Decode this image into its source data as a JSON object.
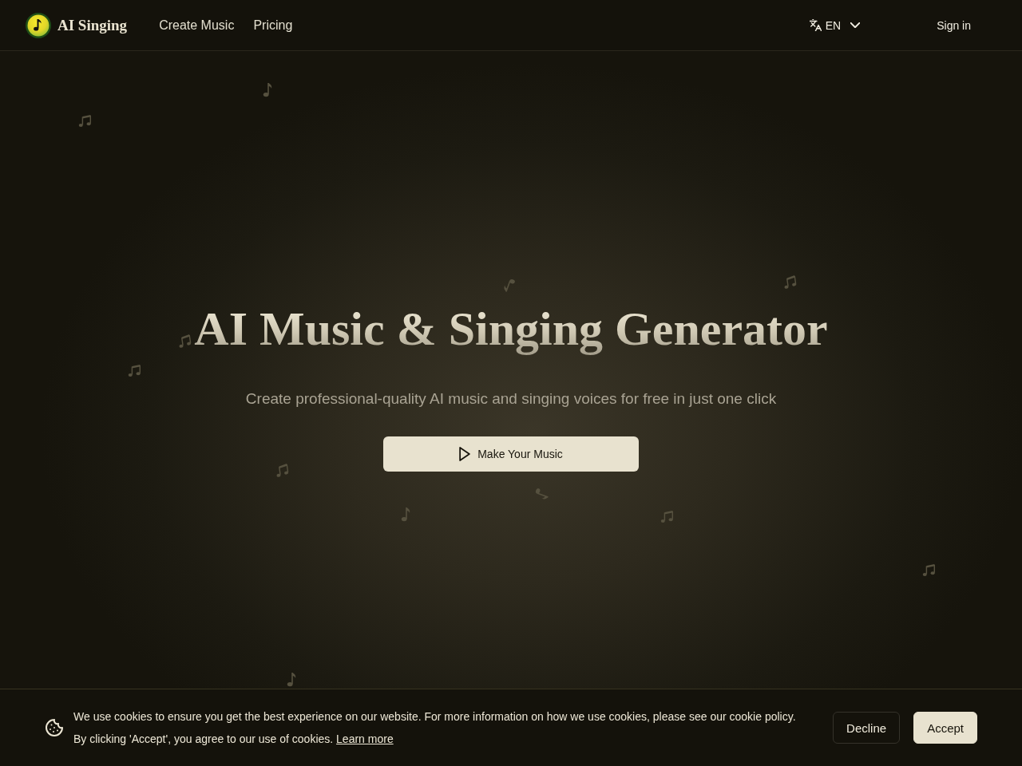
{
  "header": {
    "brand": "AI Singing",
    "nav": [
      "Create Music",
      "Pricing"
    ],
    "language": "EN",
    "sign_in": "Sign in"
  },
  "hero": {
    "title": "AI Music & Singing Generator",
    "subtitle": "Create professional-quality AI music and singing voices for free in just one click",
    "cta": "Make Your Music"
  },
  "cookie_banner": {
    "lines": [
      "We use cookies to ensure you get the best experience on our website. For more information on how we use cookies, please see our cookie policy.",
      "By clicking 'Accept', you agree to our use of cookies."
    ],
    "link": "Learn more",
    "buttons": [
      {
        "label": "Decline",
        "kind": "secondary"
      },
      {
        "label": "Accept",
        "kind": "primary"
      }
    ]
  }
}
